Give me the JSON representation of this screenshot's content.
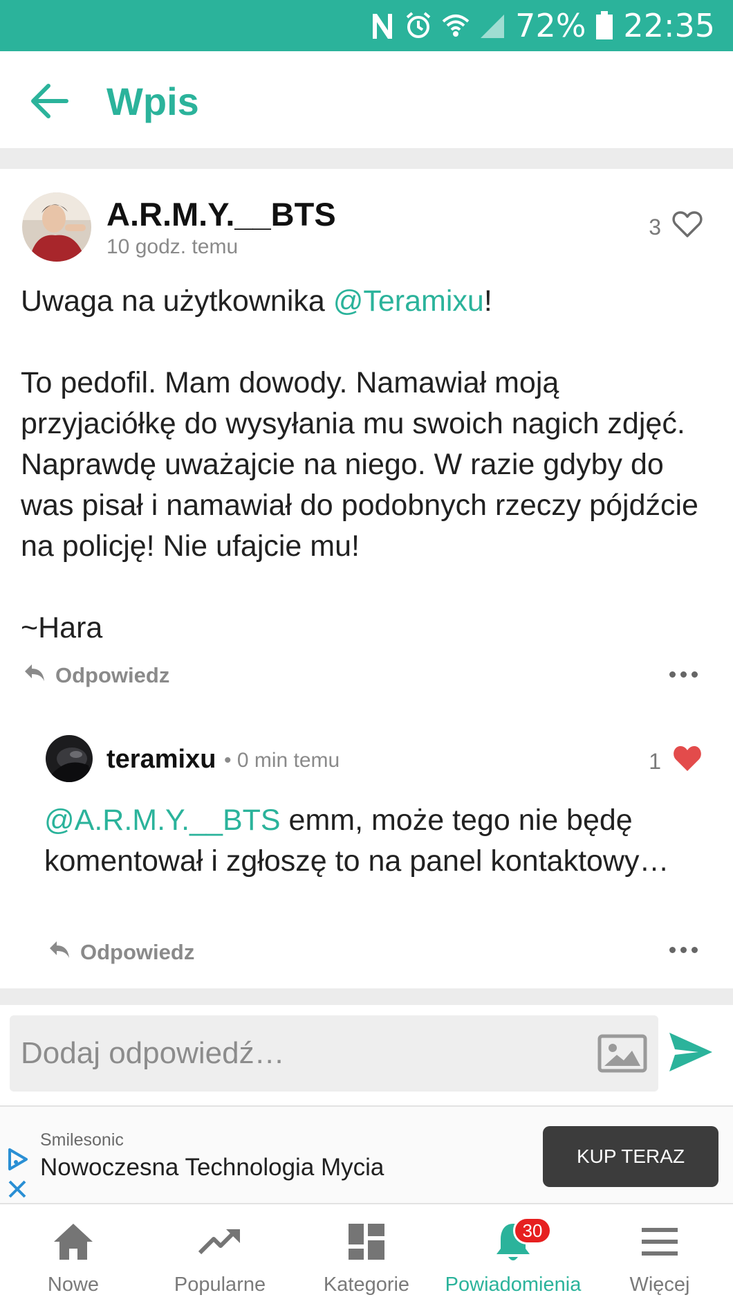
{
  "status_bar": {
    "battery_text": "72%",
    "time": "22:35",
    "icons": [
      "nfc-icon",
      "alarm-icon",
      "wifi-icon",
      "signal-icon",
      "battery-icon"
    ]
  },
  "app_bar": {
    "title": "Wpis",
    "back_icon": "arrow-left-icon"
  },
  "post": {
    "author": "A.R.M.Y.__BTS",
    "time": "10 godz. temu",
    "like_count": "3",
    "like_icon": "heart-outline-icon",
    "body": {
      "line1_prefix": "Uwaga na użytkownika ",
      "line1_mention": "@Teramixu",
      "line1_suffix": "!",
      "paragraph2": "To pedofil. Mam dowody. Namawiał moją przyjaciółkę do wysyłania mu swoich nagich zdjęć. Naprawdę uważajcie na niego. W razie gdyby do was pisał i namawiał do podobnych rzeczy pójdźcie na policję! Nie ufajcie mu!",
      "signature": "~Hara"
    },
    "reply_label": "Odpowiedz"
  },
  "comment": {
    "author": "teramixu",
    "time": "• 0 min temu",
    "like_count": "1",
    "like_icon": "heart-filled-icon",
    "mention": "@A.R.M.Y.__BTS",
    "text": " emm, może tego nie będę komentował i zgłoszę to na panel kontaktowy…",
    "reply_label": "Odpowiedz"
  },
  "composer": {
    "placeholder": "Dodaj odpowiedź…"
  },
  "ad": {
    "brand": "Smilesonic",
    "headline": "Nowoczesna Technologia Mycia",
    "cta": "KUP TERAZ"
  },
  "bottom_nav": {
    "items": [
      {
        "label": "Nowe",
        "icon": "home-icon"
      },
      {
        "label": "Popularne",
        "icon": "trending-icon"
      },
      {
        "label": "Kategorie",
        "icon": "dashboard-icon"
      },
      {
        "label": "Powiadomienia",
        "icon": "bell-icon",
        "badge": "30"
      },
      {
        "label": "Więcej",
        "icon": "menu-icon"
      }
    ],
    "active_index": 3
  },
  "colors": {
    "accent": "#2bb39b",
    "heart_filled": "#e34b4b",
    "badge": "#e62020"
  }
}
